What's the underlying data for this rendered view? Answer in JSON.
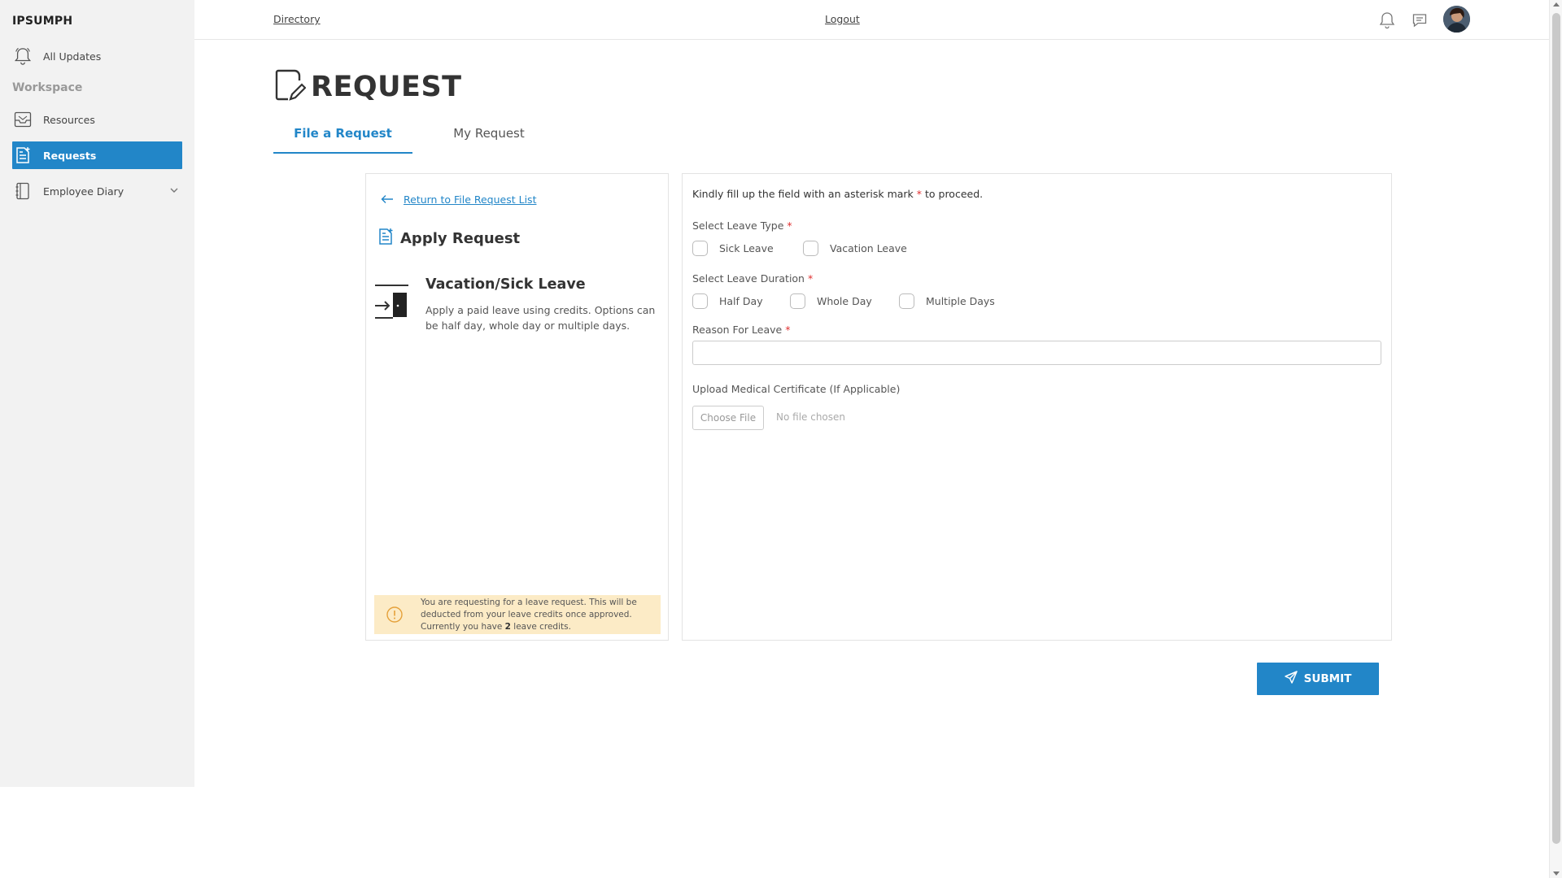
{
  "brand": "IPSUMPH",
  "sidebar": {
    "all_updates": "All Updates",
    "workspace_label": "Workspace",
    "items": [
      {
        "label": "Resources",
        "icon": "inbox-icon"
      },
      {
        "label": "Requests",
        "icon": "document-add-icon"
      },
      {
        "label": "Employee Diary",
        "icon": "notebook-icon"
      }
    ]
  },
  "topbar": {
    "directory": "Directory",
    "logout": "Logout"
  },
  "page": {
    "title": "REQUEST",
    "tabs": [
      {
        "label": "File a Request",
        "active": true
      },
      {
        "label": "My Request",
        "active": false
      }
    ]
  },
  "left_panel": {
    "back_link": "Return to File Request List",
    "apply_title": "Apply Request",
    "leave_title": "Vacation/Sick Leave",
    "leave_desc": "Apply a paid leave using credits. Options can be half day, whole day or multiple days.",
    "notice": {
      "text_before": "You are requesting for a leave request. This will be deducted from your leave credits once approved. Currently you have ",
      "credits": "2",
      "text_after": " leave credits."
    }
  },
  "form": {
    "instruction_before": "Kindly fill up the field with an asterisk mark ",
    "asterisk": "*",
    "instruction_after": " to proceed.",
    "leave_type_label": "Select Leave Type",
    "leave_type_options": [
      "Sick Leave",
      "Vacation Leave"
    ],
    "duration_label": "Select Leave Duration",
    "duration_options": [
      "Half Day",
      "Whole Day",
      "Multiple Days"
    ],
    "reason_label": "Reason For Leave",
    "reason_value": "",
    "upload_label": "Upload Medical Certificate (If Applicable)",
    "choose_file": "Choose File",
    "file_status": "No file chosen"
  },
  "submit_label": "SUBMIT",
  "colors": {
    "accent": "#2286c8",
    "sidebar_bg": "#f2f2f2",
    "notice_bg": "#fcebc6",
    "required": "#e03030"
  }
}
